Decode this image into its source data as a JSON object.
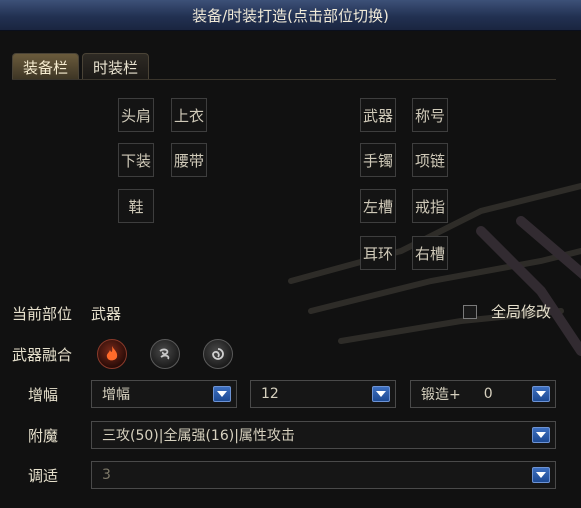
{
  "window": {
    "title": "装备/时装打造(点击部位切换)"
  },
  "tabs": [
    {
      "label": "装备栏"
    },
    {
      "label": "时装栏"
    }
  ],
  "slots": {
    "shoulder": "头肩",
    "top": "上衣",
    "bottom": "下装",
    "belt": "腰带",
    "shoes": "鞋",
    "weapon": "武器",
    "title": "称号",
    "bracelet": "手镯",
    "necklace": "项链",
    "left_slot": "左槽",
    "ring": "戒指",
    "earring": "耳环",
    "right_slot": "右槽"
  },
  "current": {
    "label": "当前部位",
    "value": "武器"
  },
  "global_edit": {
    "label": "全局修改",
    "checked": false
  },
  "fusion": {
    "label": "武器融合",
    "icons": [
      "fire-icon",
      "wind-icon",
      "swirl-icon"
    ]
  },
  "amplify": {
    "label": "增幅",
    "type_value": "增幅",
    "level_value": "12",
    "forge_label": "锻造+",
    "forge_value": "0"
  },
  "enchant": {
    "label": "附魔",
    "value": "三攻(50)|全属强(16)|属性攻击"
  },
  "tune": {
    "label": "调适",
    "value": "3"
  },
  "colors": {
    "title_bar": "#223152",
    "accent_blue": "#1d4a94",
    "tab_active": "#6a5b3c"
  }
}
